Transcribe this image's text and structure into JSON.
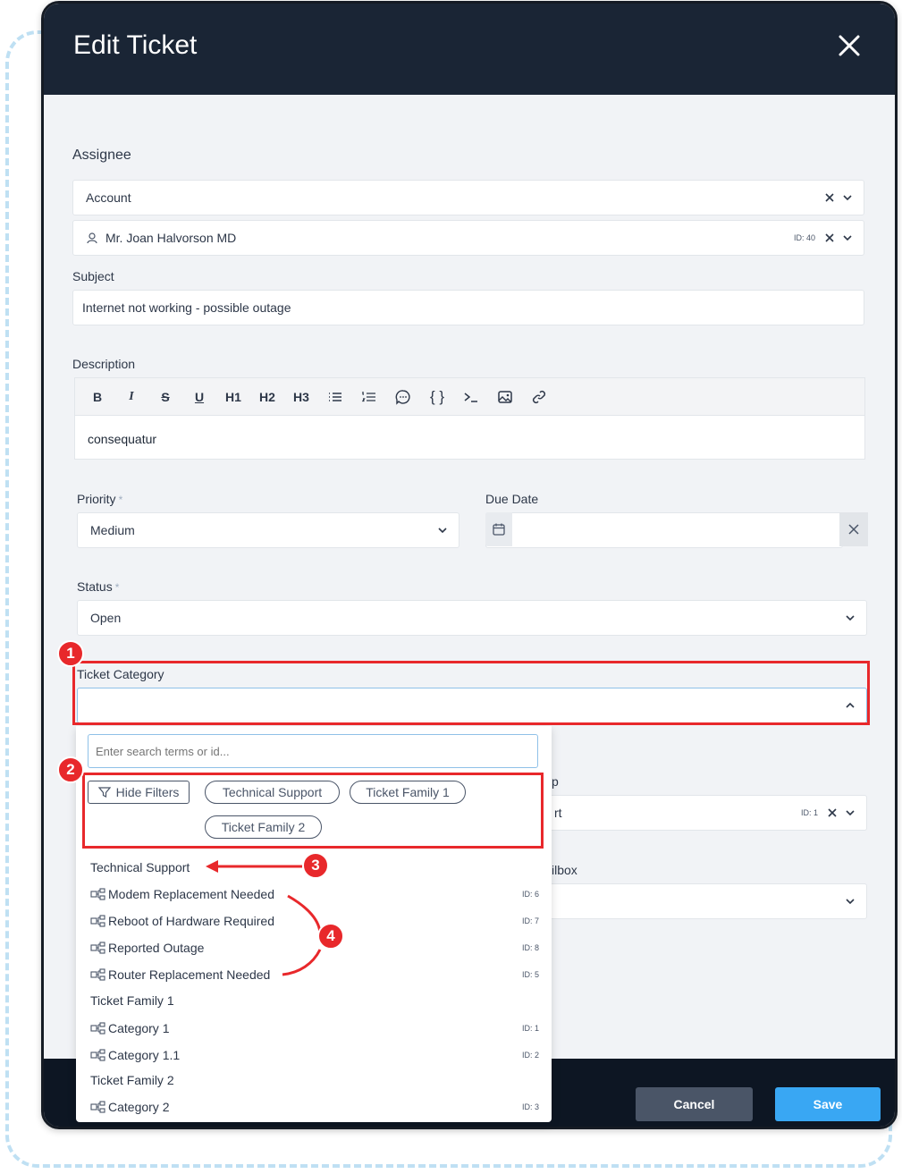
{
  "modal": {
    "title": "Edit Ticket"
  },
  "assignee": {
    "label": "Assignee",
    "type_value": "Account",
    "user_value": "Mr. Joan Halvorson MD",
    "user_id": "ID: 40"
  },
  "subject": {
    "label": "Subject",
    "value": "Internet not working - possible outage"
  },
  "description": {
    "label": "Description",
    "toolbar": [
      "B",
      "I",
      "S",
      "U",
      "H1",
      "H2",
      "H3",
      "bullet-list",
      "ordered-list",
      "comment",
      "{ }",
      "terminal",
      "image",
      "link"
    ],
    "value": "consequatur"
  },
  "priority": {
    "label": "Priority",
    "required_mark": "*",
    "value": "Medium"
  },
  "due_date": {
    "label": "Due Date",
    "value": ""
  },
  "status": {
    "label": "Status",
    "required_mark": "*",
    "value": "Open"
  },
  "ticket_category": {
    "label": "Ticket Category",
    "value": ""
  },
  "hidden_fields": {
    "group_label_fragment": "p",
    "group_value_fragment": "rt",
    "group_id": "ID: 1",
    "mailbox_label_fragment": "ilbox"
  },
  "dropdown": {
    "search_placeholder": "Enter search terms or id...",
    "hide_filters_label": "Hide Filters",
    "filter_chips": [
      "Technical Support",
      "Ticket Family 1",
      "Ticket Family 2"
    ],
    "groups": [
      {
        "name": "Technical Support",
        "options": [
          {
            "label": "Modem Replacement Needed",
            "id": "ID: 6"
          },
          {
            "label": "Reboot of Hardware Required",
            "id": "ID: 7"
          },
          {
            "label": "Reported Outage",
            "id": "ID: 8"
          },
          {
            "label": "Router Replacement Needed",
            "id": "ID: 5"
          }
        ]
      },
      {
        "name": "Ticket Family 1",
        "options": [
          {
            "label": "Category 1",
            "id": "ID: 1"
          },
          {
            "label": "Category 1.1",
            "id": "ID: 2"
          }
        ]
      },
      {
        "name": "Ticket Family 2",
        "options": [
          {
            "label": "Category 2",
            "id": "ID: 3"
          }
        ]
      }
    ]
  },
  "footer": {
    "cancel_label": "Cancel",
    "save_label": "Save"
  },
  "annotations": {
    "badges": [
      "1",
      "2",
      "3",
      "4"
    ],
    "color": "#e8282b"
  },
  "colors": {
    "header_bg": "#1a2535",
    "save_bg": "#39a7f3",
    "cancel_bg": "#4a5567",
    "panel_bg": "#f1f3f6"
  }
}
